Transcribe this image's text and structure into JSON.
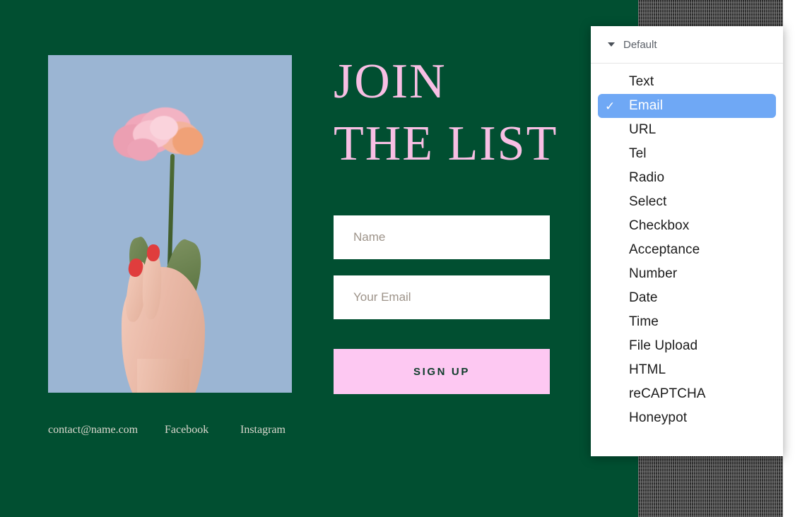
{
  "page": {
    "background_color": "#014f31",
    "accent_pink": "#fdc8f2",
    "headline_pink": "#f8bfe4"
  },
  "hero": {
    "headline_line1": "JOIN",
    "headline_line2": "THE LIST",
    "photo_alt": "pink carnation held in a hand on light blue background",
    "photo_background_color": "#9bb5d3"
  },
  "form": {
    "name_placeholder": "Name",
    "name_value": "",
    "email_placeholder": "Your Email",
    "email_value": "",
    "submit_label": "SIGN UP"
  },
  "footer": {
    "links": [
      {
        "label": "contact@name.com"
      },
      {
        "label": "Facebook"
      },
      {
        "label": "Instagram"
      }
    ]
  },
  "dropdown": {
    "header_label": "Default",
    "caret_icon": "triangle-down-icon",
    "check_glyph": "✓",
    "selected_value": "Email",
    "highlight_color": "#6fa8f5",
    "options": [
      {
        "label": "Text",
        "selected": false
      },
      {
        "label": "Email",
        "selected": true
      },
      {
        "label": "URL",
        "selected": false
      },
      {
        "label": "Tel",
        "selected": false
      },
      {
        "label": "Radio",
        "selected": false
      },
      {
        "label": "Select",
        "selected": false
      },
      {
        "label": "Checkbox",
        "selected": false
      },
      {
        "label": "Acceptance",
        "selected": false
      },
      {
        "label": "Number",
        "selected": false
      },
      {
        "label": "Date",
        "selected": false
      },
      {
        "label": "Time",
        "selected": false
      },
      {
        "label": "File Upload",
        "selected": false
      },
      {
        "label": "HTML",
        "selected": false
      },
      {
        "label": "reCAPTCHA",
        "selected": false
      },
      {
        "label": "Honeypot",
        "selected": false
      }
    ]
  }
}
